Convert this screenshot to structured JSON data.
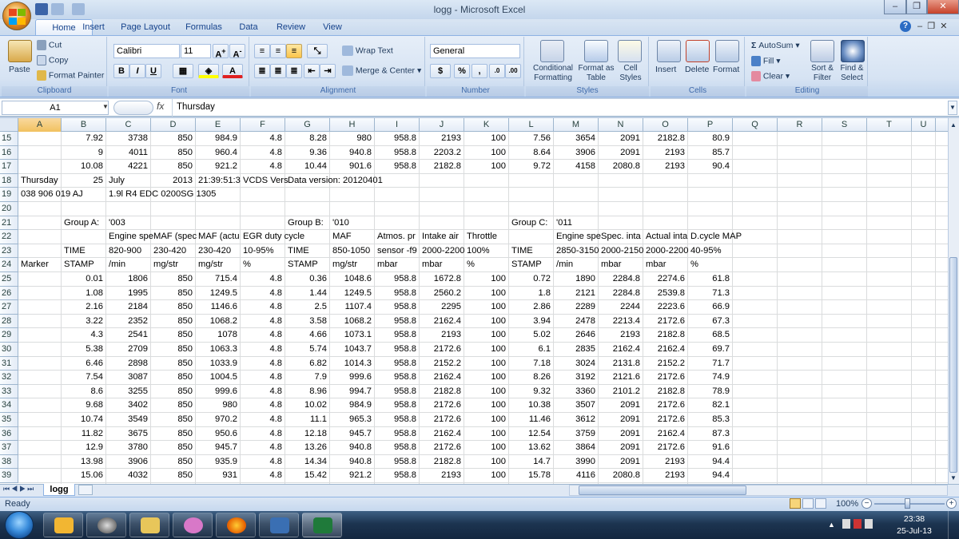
{
  "window": {
    "title": "logg - Microsoft Excel"
  },
  "ribbon": {
    "tabs": [
      "Home",
      "Insert",
      "Page Layout",
      "Formulas",
      "Data",
      "Review",
      "View"
    ],
    "clipboard": {
      "paste": "Paste",
      "cut": "Cut",
      "copy": "Copy",
      "format_painter": "Format Painter",
      "label": "Clipboard"
    },
    "font": {
      "name": "Calibri",
      "size": "11",
      "label": "Font"
    },
    "alignment": {
      "wrap": "Wrap Text",
      "merge": "Merge & Center",
      "label": "Alignment"
    },
    "number": {
      "format": "General",
      "label": "Number"
    },
    "styles": {
      "conditional": "Conditional Formatting",
      "format_table": "Format as Table",
      "cell_styles": "Cell Styles",
      "label": "Styles"
    },
    "cells": {
      "insert": "Insert",
      "delete": "Delete",
      "format": "Format",
      "label": "Cells"
    },
    "editing": {
      "autosum": "AutoSum",
      "fill": "Fill",
      "clear": "Clear",
      "sort": "Sort & Filter",
      "find": "Find & Select",
      "label": "Editing"
    }
  },
  "formula_bar": {
    "name_box": "A1",
    "fx": "fx",
    "content": "Thursday"
  },
  "sheet": {
    "columns": [
      "A",
      "B",
      "C",
      "D",
      "E",
      "F",
      "G",
      "H",
      "I",
      "J",
      "K",
      "L",
      "M",
      "N",
      "O",
      "P",
      "Q",
      "R",
      "S",
      "T",
      "U"
    ],
    "rows": [
      {
        "n": "15",
        "c": [
          "",
          "7.92",
          "3738",
          "850",
          "984.9",
          "4.8",
          "8.28",
          "980",
          "958.8",
          "2193",
          "100",
          "7.56",
          "3654",
          "2091",
          "2182.8",
          "80.9"
        ]
      },
      {
        "n": "16",
        "c": [
          "",
          "9",
          "4011",
          "850",
          "960.4",
          "4.8",
          "9.36",
          "940.8",
          "958.8",
          "2203.2",
          "100",
          "8.64",
          "3906",
          "2091",
          "2193",
          "85.7"
        ]
      },
      {
        "n": "17",
        "c": [
          "",
          "10.08",
          "4221",
          "850",
          "921.2",
          "4.8",
          "10.44",
          "901.6",
          "958.8",
          "2182.8",
          "100",
          "9.72",
          "4158",
          "2080.8",
          "2193",
          "90.4"
        ]
      },
      {
        "n": "18",
        "c": [
          "Thursday",
          "25",
          "July",
          "2013",
          "21:39:51:3",
          "VCDS Vers",
          "Data version: 20120401",
          "",
          "",
          "",
          "",
          "",
          "",
          "",
          "",
          ""
        ]
      },
      {
        "n": "19",
        "c": [
          "038 906 019 AJ",
          "",
          "1.9l R4 EDC 0200SG  1305",
          "",
          "",
          "",
          "",
          "",
          "",
          "",
          "",
          "",
          "",
          "",
          "",
          ""
        ]
      },
      {
        "n": "20",
        "c": [
          "",
          "",
          "",
          "",
          "",
          "",
          "",
          "",
          "",
          "",
          "",
          "",
          "",
          "",
          "",
          ""
        ]
      },
      {
        "n": "21",
        "c": [
          "",
          "Group A:",
          "'003",
          "",
          "",
          "",
          "Group B:",
          "'010",
          "",
          "",
          "",
          "Group C:",
          "'011",
          "",
          "",
          ""
        ]
      },
      {
        "n": "22",
        "c": [
          "",
          "",
          "Engine spe",
          "MAF (spec",
          "MAF (actu",
          "EGR duty cycle",
          "",
          "MAF",
          "Atmos. pr",
          "Intake air",
          "Throttle",
          "",
          "Engine spe",
          "Spec. inta",
          "Actual inta",
          "D.cycle MAP"
        ]
      },
      {
        "n": "23",
        "c": [
          "",
          "TIME",
          "820-900",
          "230-420",
          "230-420",
          "10-95%",
          "TIME",
          "850-1050",
          "sensor -f9",
          "2000-2200",
          "100%",
          "TIME",
          "2850-3150",
          "2000-2150",
          "2000-2200",
          "40-95%"
        ]
      },
      {
        "n": "24",
        "c": [
          "Marker",
          "STAMP",
          "/min",
          "mg/str",
          "mg/str",
          "%",
          "STAMP",
          "mg/str",
          "mbar",
          "mbar",
          "%",
          "STAMP",
          "/min",
          "mbar",
          "mbar",
          "%"
        ]
      },
      {
        "n": "25",
        "c": [
          "",
          "0.01",
          "1806",
          "850",
          "715.4",
          "4.8",
          "0.36",
          "1048.6",
          "958.8",
          "1672.8",
          "100",
          "0.72",
          "1890",
          "2284.8",
          "2274.6",
          "61.8"
        ]
      },
      {
        "n": "26",
        "c": [
          "",
          "1.08",
          "1995",
          "850",
          "1249.5",
          "4.8",
          "1.44",
          "1249.5",
          "958.8",
          "2560.2",
          "100",
          "1.8",
          "2121",
          "2284.8",
          "2539.8",
          "71.3"
        ]
      },
      {
        "n": "27",
        "c": [
          "",
          "2.16",
          "2184",
          "850",
          "1146.6",
          "4.8",
          "2.5",
          "1107.4",
          "958.8",
          "2295",
          "100",
          "2.86",
          "2289",
          "2244",
          "2223.6",
          "66.9"
        ]
      },
      {
        "n": "28",
        "c": [
          "",
          "3.22",
          "2352",
          "850",
          "1068.2",
          "4.8",
          "3.58",
          "1068.2",
          "958.8",
          "2162.4",
          "100",
          "3.94",
          "2478",
          "2213.4",
          "2172.6",
          "67.3"
        ]
      },
      {
        "n": "29",
        "c": [
          "",
          "4.3",
          "2541",
          "850",
          "1078",
          "4.8",
          "4.66",
          "1073.1",
          "958.8",
          "2193",
          "100",
          "5.02",
          "2646",
          "2193",
          "2182.8",
          "68.5"
        ]
      },
      {
        "n": "30",
        "c": [
          "",
          "5.38",
          "2709",
          "850",
          "1063.3",
          "4.8",
          "5.74",
          "1043.7",
          "958.8",
          "2172.6",
          "100",
          "6.1",
          "2835",
          "2162.4",
          "2162.4",
          "69.7"
        ]
      },
      {
        "n": "31",
        "c": [
          "",
          "6.46",
          "2898",
          "850",
          "1033.9",
          "4.8",
          "6.82",
          "1014.3",
          "958.8",
          "2152.2",
          "100",
          "7.18",
          "3024",
          "2131.8",
          "2152.2",
          "71.7"
        ]
      },
      {
        "n": "32",
        "c": [
          "",
          "7.54",
          "3087",
          "850",
          "1004.5",
          "4.8",
          "7.9",
          "999.6",
          "958.8",
          "2162.4",
          "100",
          "8.26",
          "3192",
          "2121.6",
          "2172.6",
          "74.9"
        ]
      },
      {
        "n": "33",
        "c": [
          "",
          "8.6",
          "3255",
          "850",
          "999.6",
          "4.8",
          "8.96",
          "994.7",
          "958.8",
          "2182.8",
          "100",
          "9.32",
          "3360",
          "2101.2",
          "2182.8",
          "78.9"
        ]
      },
      {
        "n": "34",
        "c": [
          "",
          "9.68",
          "3402",
          "850",
          "980",
          "4.8",
          "10.02",
          "984.9",
          "958.8",
          "2172.6",
          "100",
          "10.38",
          "3507",
          "2091",
          "2172.6",
          "82.1"
        ]
      },
      {
        "n": "35",
        "c": [
          "",
          "10.74",
          "3549",
          "850",
          "970.2",
          "4.8",
          "11.1",
          "965.3",
          "958.8",
          "2172.6",
          "100",
          "11.46",
          "3612",
          "2091",
          "2172.6",
          "85.3"
        ]
      },
      {
        "n": "36",
        "c": [
          "",
          "11.82",
          "3675",
          "850",
          "950.6",
          "4.8",
          "12.18",
          "945.7",
          "958.8",
          "2162.4",
          "100",
          "12.54",
          "3759",
          "2091",
          "2162.4",
          "87.3"
        ]
      },
      {
        "n": "37",
        "c": [
          "",
          "12.9",
          "3780",
          "850",
          "945.7",
          "4.8",
          "13.26",
          "940.8",
          "958.8",
          "2172.6",
          "100",
          "13.62",
          "3864",
          "2091",
          "2172.6",
          "91.6"
        ]
      },
      {
        "n": "38",
        "c": [
          "",
          "13.98",
          "3906",
          "850",
          "935.9",
          "4.8",
          "14.34",
          "940.8",
          "958.8",
          "2182.8",
          "100",
          "14.7",
          "3990",
          "2091",
          "2193",
          "94.4"
        ]
      },
      {
        "n": "39",
        "c": [
          "",
          "15.06",
          "4032",
          "850",
          "931",
          "4.8",
          "15.42",
          "921.2",
          "958.8",
          "2193",
          "100",
          "15.78",
          "4116",
          "2080.8",
          "2193",
          "94.4"
        ]
      }
    ]
  },
  "sheet_tab": "logg",
  "status": {
    "ready": "Ready",
    "zoom": "100%"
  },
  "taskbar": {
    "time": "23:38",
    "date": "25-Jul-13"
  }
}
